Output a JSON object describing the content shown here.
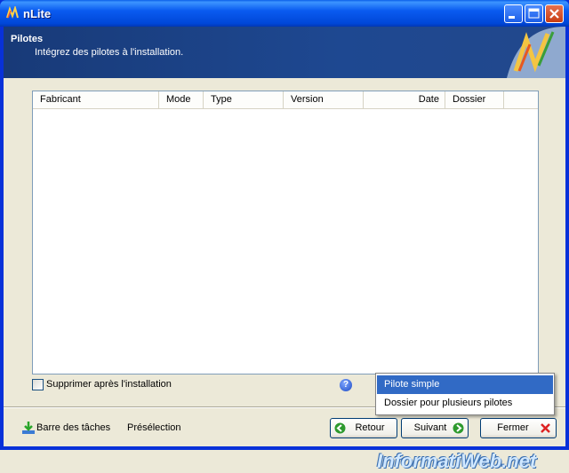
{
  "window": {
    "title": "nLite"
  },
  "header": {
    "title": "Pilotes",
    "subtitle": "Intégrez des pilotes à l'installation."
  },
  "table": {
    "columns": [
      "Fabricant",
      "Mode",
      "Type",
      "Version",
      "Date",
      "Dossier"
    ],
    "rows": []
  },
  "options": {
    "delete_after_install_label": "Supprimer après l'installation",
    "delete_after_install_checked": false
  },
  "help_symbol": "?",
  "footer": {
    "taskbar_label": "Barre des tâches",
    "preset_label": "Présélection",
    "back_label": "Retour",
    "next_label": "Suivant",
    "close_label": "Fermer"
  },
  "context_menu": {
    "items": [
      {
        "label": "Pilote simple",
        "selected": true
      },
      {
        "label": "Dossier pour plusieurs pilotes",
        "selected": false
      }
    ]
  },
  "watermark": "InformatiWeb.net"
}
